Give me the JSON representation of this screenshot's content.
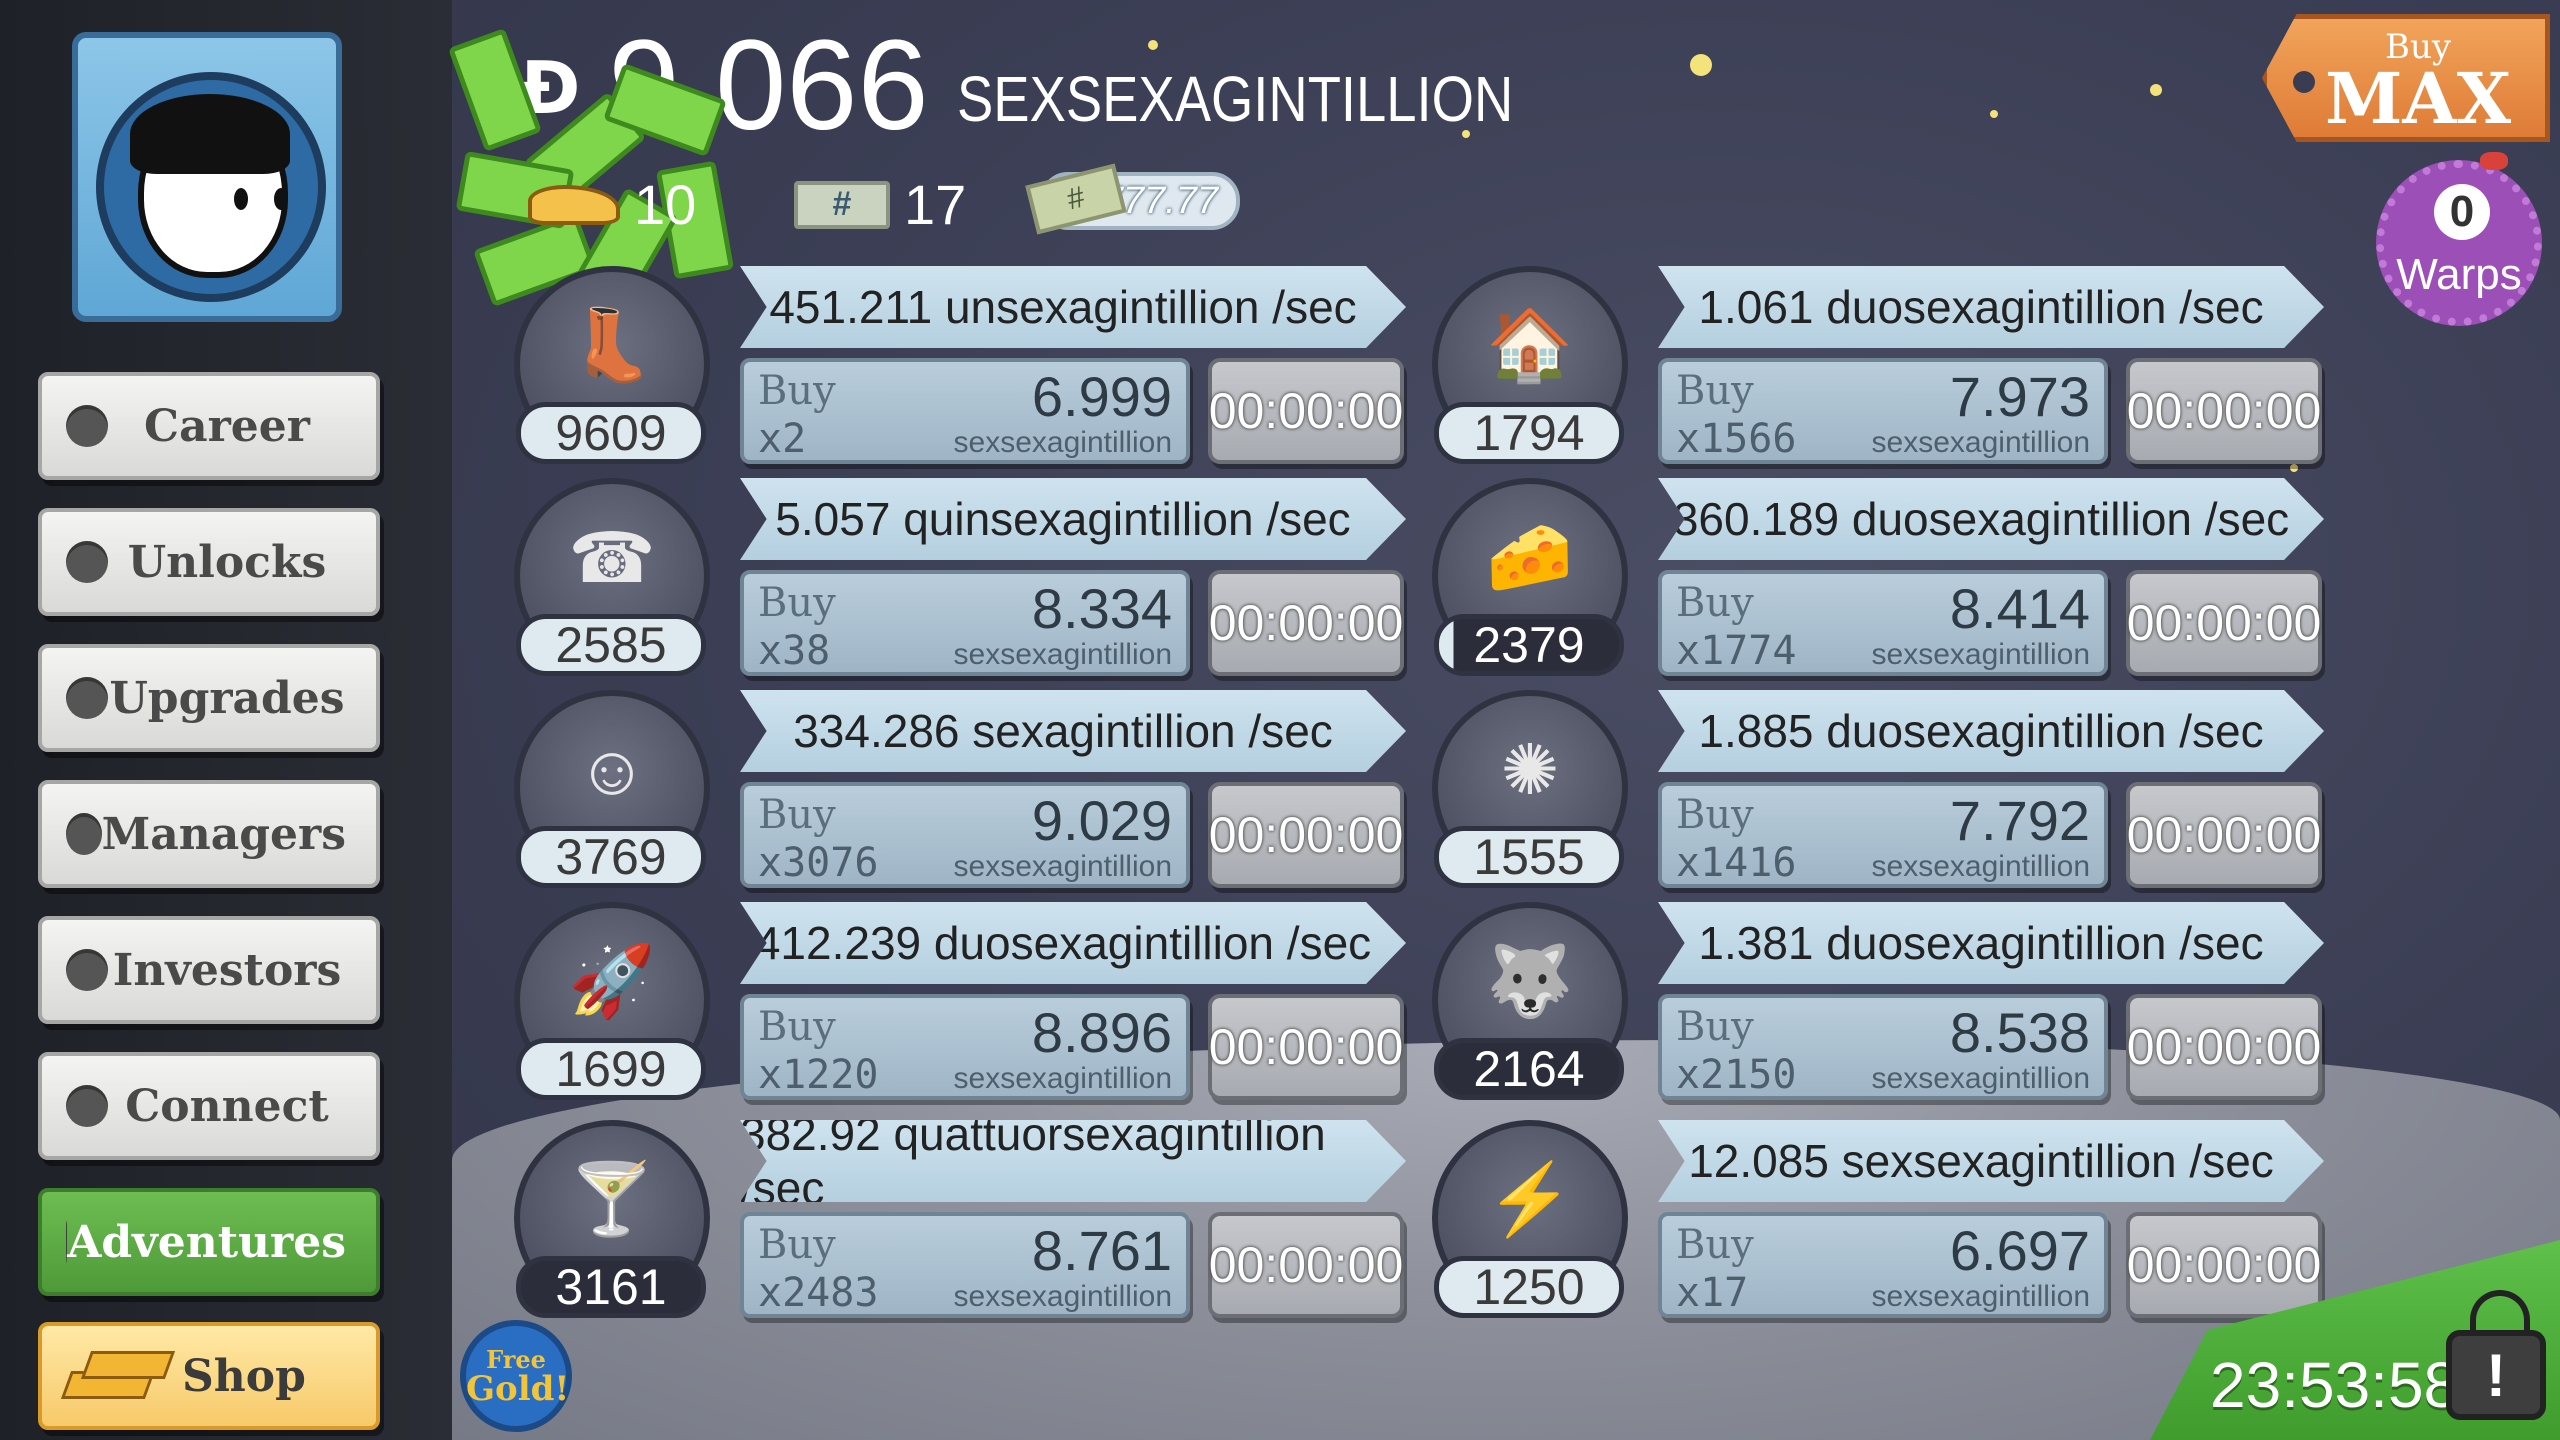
{
  "money": {
    "symbol": "Ð",
    "amount": "9.066",
    "unit": "SEXSEXAGINTILLION"
  },
  "stats": {
    "angels": "10",
    "tickets": "17",
    "ticket_symbol": "#",
    "multiplier": "x777.77",
    "multiplier_ticket_symbol": "#"
  },
  "buy_max": {
    "small": "Buy",
    "big": "MAX"
  },
  "warps": {
    "count": "0",
    "label": "Warps"
  },
  "sidebar": {
    "items": [
      {
        "label": "Career"
      },
      {
        "label": "Unlocks"
      },
      {
        "label": "Upgrades"
      },
      {
        "label": "Managers"
      },
      {
        "label": "Investors"
      },
      {
        "label": "Connect"
      },
      {
        "label": "Adventures"
      },
      {
        "label": "Shop"
      }
    ]
  },
  "businesses": [
    {
      "icon": "moon-boots-icon",
      "glyph": "👢",
      "owned": "9609",
      "rate": "451.211 unsexagintillion /sec",
      "buy_label": "Buy",
      "buy_qty": "x2",
      "price": "6.999",
      "price_unit": "sexsexagintillion",
      "timer": "00:00:00"
    },
    {
      "icon": "moon-barn-icon",
      "glyph": "🏠",
      "owned": "1794",
      "rate": "1.061 duosexagintillion /sec",
      "buy_label": "Buy",
      "buy_qty": "x1566",
      "price": "7.973",
      "price_unit": "sexsexagintillion",
      "timer": "00:00:00"
    },
    {
      "icon": "phone-booth-icon",
      "glyph": "☎",
      "owned": "2585",
      "rate": "5.057 quinsexagintillion /sec",
      "buy_label": "Buy",
      "buy_qty": "x38",
      "price": "8.334",
      "price_unit": "sexsexagintillion",
      "timer": "00:00:00"
    },
    {
      "icon": "cheese-cart-icon",
      "glyph": "🧀",
      "owned": "2379",
      "rate": "360.189 duosexagintillion /sec",
      "buy_label": "Buy",
      "buy_qty": "x1774",
      "price": "8.414",
      "price_unit": "sexsexagintillion",
      "timer": "00:00:00"
    },
    {
      "icon": "alien-podium-icon",
      "glyph": "☺",
      "owned": "3769",
      "rate": "334.286 sexagintillion /sec",
      "buy_label": "Buy",
      "buy_qty": "x3076",
      "price": "9.029",
      "price_unit": "sexsexagintillion",
      "timer": "00:00:00"
    },
    {
      "icon": "satellite-dish-icon",
      "glyph": "✺",
      "owned": "1555",
      "rate": "1.885 duosexagintillion /sec",
      "buy_label": "Buy",
      "buy_qty": "x1416",
      "price": "7.792",
      "price_unit": "sexsexagintillion",
      "timer": "00:00:00"
    },
    {
      "icon": "moon-rocket-icon",
      "glyph": "🚀",
      "owned": "1699",
      "rate": "412.239 duosexagintillion /sec",
      "buy_label": "Buy",
      "buy_qty": "x1220",
      "price": "8.896",
      "price_unit": "sexsexagintillion",
      "timer": "00:00:00"
    },
    {
      "icon": "werewolf-icon",
      "glyph": "🐺",
      "owned": "2164",
      "rate": "1.381 duosexagintillion /sec",
      "buy_label": "Buy",
      "buy_qty": "x2150",
      "price": "8.538",
      "price_unit": "sexsexagintillion",
      "timer": "00:00:00"
    },
    {
      "icon": "cocktail-glass-icon",
      "glyph": "🍸",
      "owned": "3161",
      "rate": "382.92 quattuorsexagintillion /sec",
      "buy_label": "Buy",
      "buy_qty": "x2483",
      "price": "8.761",
      "price_unit": "sexsexagintillion",
      "timer": "00:00:00"
    },
    {
      "icon": "ray-gun-icon",
      "glyph": "⚡",
      "owned": "1250",
      "rate": "12.085 sexsexagintillion /sec",
      "buy_label": "Buy",
      "buy_qty": "x17",
      "price": "6.697",
      "price_unit": "sexsexagintillion",
      "timer": "00:00:00"
    }
  ],
  "free_gold": {
    "line1": "Free",
    "line2": "Gold!"
  },
  "event_timer": "23:53:58",
  "event_icon_symbol": "!",
  "colors": {
    "background": "#3a3d52",
    "active_nav": "#5aa943",
    "shop_nav": "#f7c96a",
    "buy_max_tag": "#e88b43",
    "warps_badge": "#9b4fb7"
  }
}
